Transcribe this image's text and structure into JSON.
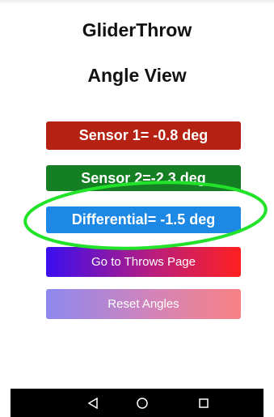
{
  "app": {
    "title": "GliderThrow",
    "page_title": "Angle View"
  },
  "readouts": {
    "sensor1": "Sensor 1= -0.8 deg",
    "sensor2": "Sensor 2=-2.3 deg",
    "differential": "Differential= -1.5 deg"
  },
  "buttons": {
    "throws_page": "Go to Throws Page",
    "reset_angles": "Reset Angles"
  },
  "annotation": {
    "highlight_color": "#22e32a"
  },
  "colors": {
    "sensor1": "#b52213",
    "sensor2": "#157f24",
    "differential": "#1e88e5"
  },
  "navbar": {
    "icons": [
      "back-icon",
      "home-icon",
      "recents-icon"
    ]
  }
}
